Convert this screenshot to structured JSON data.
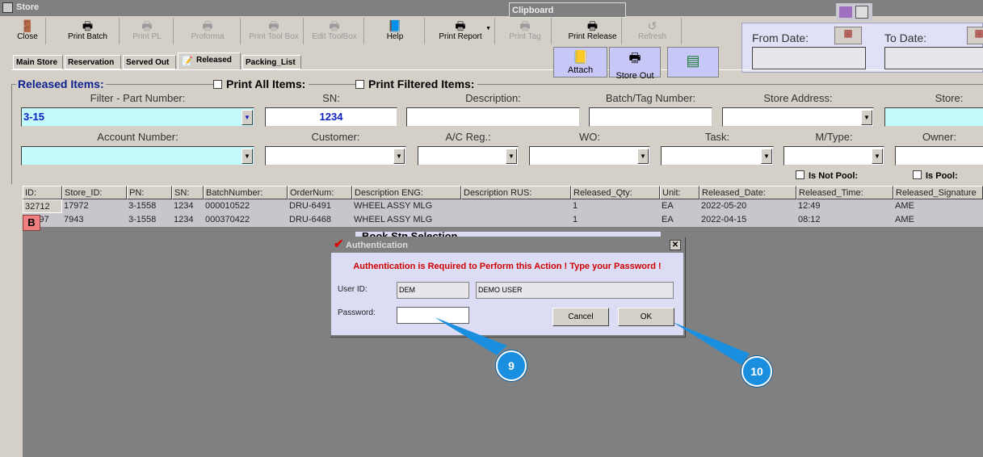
{
  "window": {
    "title": "Store"
  },
  "toolbar": [
    {
      "label": "Close",
      "icon": "door-exit-icon",
      "enabled": true
    },
    {
      "label": "Print Batch",
      "icon": "printer-icon",
      "enabled": true
    },
    {
      "label": "Print PL",
      "icon": "printer-icon",
      "enabled": false
    },
    {
      "label": "Proforma",
      "icon": "printer-icon",
      "enabled": false
    },
    {
      "label": "Print Tool Box",
      "icon": "printer-icon",
      "enabled": false
    },
    {
      "label": "Edit ToolBox",
      "icon": "printer-icon",
      "enabled": false
    },
    {
      "label": "Help",
      "icon": "help-book-icon",
      "enabled": true
    },
    {
      "label": "Print Report",
      "icon": "printer-icon",
      "enabled": true
    },
    {
      "label": "Print Tag",
      "icon": "printer-icon",
      "enabled": false
    },
    {
      "label": "Print Release",
      "icon": "printer-icon",
      "enabled": true
    },
    {
      "label": "Refresh",
      "icon": "refresh-icon",
      "enabled": false
    }
  ],
  "clipboard": {
    "label": "Clipboard"
  },
  "tabs": [
    "Main Store",
    "Reservation",
    "Served Out",
    "Released",
    "Packing_List"
  ],
  "active_tab": "Released",
  "actions": {
    "attach": "Attach",
    "store_out": "Store Out",
    "excel_icon": "excel-export-icon"
  },
  "dates": {
    "from_label": "From Date:",
    "to_label": "To Date:",
    "from_value": "",
    "to_value": ""
  },
  "filters": {
    "group_title": "Released Items:",
    "print_all": "Print All Items:",
    "print_filtered": "Print Filtered Items:",
    "part_number": {
      "label": "Filter - Part Number:",
      "value": "3-15"
    },
    "sn": {
      "label": "SN:",
      "value": "1234"
    },
    "description": {
      "label": "Description:",
      "value": ""
    },
    "batch": {
      "label": "Batch/Tag Number:",
      "value": ""
    },
    "store_address": {
      "label": "Store Address:",
      "value": ""
    },
    "store": {
      "label": "Store:",
      "value": ""
    },
    "account": {
      "label": "Account Number:",
      "value": ""
    },
    "customer": {
      "label": "Customer:",
      "value": ""
    },
    "ac_reg": {
      "label": "A/C Reg.:",
      "value": ""
    },
    "wo": {
      "label": "WO:",
      "value": ""
    },
    "task": {
      "label": "Task:",
      "value": ""
    },
    "mtype": {
      "label": "M/Type:",
      "value": ""
    },
    "owner": {
      "label": "Owner:",
      "value": ""
    },
    "is_not_pool": "Is Not Pool:",
    "is_pool": "Is Pool:"
  },
  "grid": {
    "columns": [
      "ID:",
      "Store_ID:",
      "PN:",
      "SN:",
      "BatchNumber:",
      "OrderNum:",
      "Description ENG:",
      "Description RUS:",
      "Released_Qty:",
      "Unit:",
      "Released_Date:",
      "Released_Time:",
      "Released_Signature"
    ],
    "rows": [
      [
        "32712",
        "17972",
        "3-1558",
        "1234",
        "000010522",
        "DRU-6491",
        "WHEEL ASSY MLG",
        "",
        "1",
        "EA",
        "2022-05-20",
        "12:49",
        "AME"
      ],
      [
        "32697",
        "7943",
        "3-1558",
        "1234",
        "000370422",
        "DRU-6468",
        "WHEEL ASSY MLG",
        "",
        "1",
        "EA",
        "2022-04-15",
        "08:12",
        "AME"
      ]
    ],
    "badge": "B"
  },
  "background_window": {
    "title": "Book Stn Selection"
  },
  "dialog": {
    "title": "Authentication",
    "message": "Authentication is Required to Perform this Action ! Type your Password !",
    "user_id_label": "User ID:",
    "user_id": "DEM",
    "user_name": "DEMO USER",
    "password_label": "Password:",
    "password": "",
    "cancel": "Cancel",
    "ok": "OK",
    "message_color": "#d00000"
  },
  "callouts": [
    "9",
    "10"
  ]
}
